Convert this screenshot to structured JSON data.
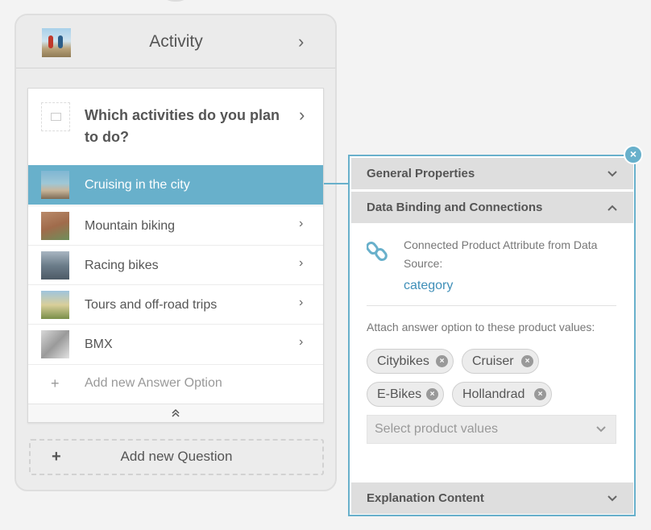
{
  "question": {
    "header_title": "Activity",
    "inner_title": "Which activities do you plan to do?",
    "options": [
      {
        "label": "Cruising in the city",
        "active": true
      },
      {
        "label": "Mountain biking",
        "active": false
      },
      {
        "label": "Racing bikes",
        "active": false
      },
      {
        "label": "Tours and off-road trips",
        "active": false
      },
      {
        "label": "BMX",
        "active": false
      }
    ],
    "add_option_label": "Add new Answer Option",
    "add_question_label": "Add new Question",
    "chevron": "›",
    "plus": "+",
    "collapse_glyph": "⌃"
  },
  "panel": {
    "sections": {
      "general": "General Properties",
      "binding": "Data Binding and Connections",
      "explanation": "Explanation Content"
    },
    "connected_label": "Connected Product Attribute from Data Source:",
    "connected_value": "category",
    "attach_label": "Attach answer option to these product values:",
    "tags": [
      "Citybikes",
      "Cruiser",
      "E-Bikes",
      "Hollandrad"
    ],
    "select_placeholder": "Select product values",
    "close_glyph": "×",
    "chevron_down": "⌄",
    "chevron_up": "⌃"
  },
  "colors": {
    "accent": "#68b0cb",
    "link": "#3f8fb8"
  },
  "icons": [
    "image-placeholder-icon",
    "link-icon",
    "chevron-right-icon",
    "chevron-down-icon",
    "chevron-up-icon",
    "close-icon",
    "plus-icon",
    "remove-tag-icon",
    "collapse-up-icon"
  ]
}
